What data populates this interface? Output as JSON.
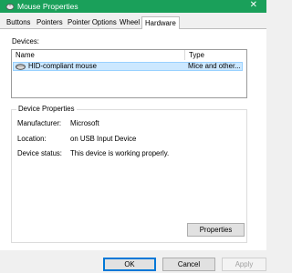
{
  "window": {
    "title": "Mouse Properties",
    "close_glyph": "✕",
    "title_bar_color": "#1aa05a"
  },
  "tabs": [
    {
      "label": "Buttons"
    },
    {
      "label": "Pointers"
    },
    {
      "label": "Pointer Options"
    },
    {
      "label": "Wheel"
    },
    {
      "label": "Hardware",
      "active": true
    }
  ],
  "devices": {
    "label": "Devices:",
    "columns": {
      "name": "Name",
      "type": "Type"
    },
    "rows": [
      {
        "name": "HID-compliant mouse",
        "type": "Mice and other...",
        "selected": true,
        "icon": "mouse-icon"
      }
    ]
  },
  "device_properties": {
    "title": "Device Properties",
    "manufacturer_label": "Manufacturer:",
    "manufacturer_value": "Microsoft",
    "location_label": "Location:",
    "location_value": "on USB Input Device",
    "status_label": "Device status:",
    "status_value": "This device is working properly.",
    "properties_button": "Properties"
  },
  "footer": {
    "ok": "OK",
    "cancel": "Cancel",
    "apply": "Apply"
  },
  "colors": {
    "selection_fill": "#cce8ff",
    "selection_border": "#99d1ff",
    "default_button_border": "#0078d7"
  }
}
